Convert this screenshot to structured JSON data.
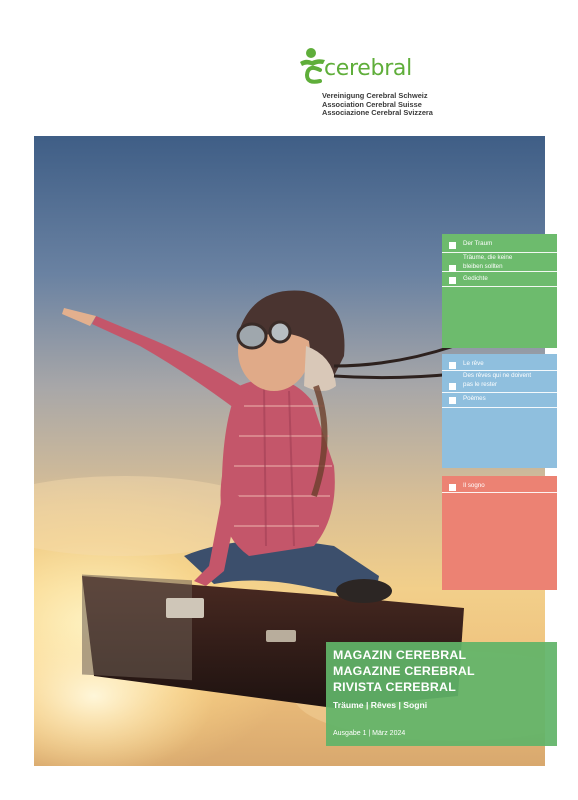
{
  "header": {
    "logo_word": "cerebral",
    "association_lines": [
      "Vereinigung Cerebral Schweiz",
      "Association Cerebral Suisse",
      "Associazione Cerebral Svizzera"
    ],
    "brand_color": "#5fae3a"
  },
  "contents": {
    "german": {
      "color": "#6dbb6d",
      "items": [
        "Der Traum",
        "Träume, die keine",
        "bleiben sollten",
        "Gedichte"
      ]
    },
    "french": {
      "color": "#8fbfde",
      "items": [
        "Le rêve",
        "Des rêves qui ne doivent",
        "pas le rester",
        "Poèmes"
      ]
    },
    "italian": {
      "color": "#ec8273",
      "items": [
        "Il sogno"
      ]
    }
  },
  "title": {
    "lines": [
      "MAGAZIN CEREBRAL",
      "MAGAZINE CEREBRAL",
      "RIVISTA CEREBRAL"
    ],
    "subtitle": "Träume | Rêves | Sogni",
    "issue": "Ausgabe 1 | März 2024",
    "box_color": "#61b468"
  }
}
